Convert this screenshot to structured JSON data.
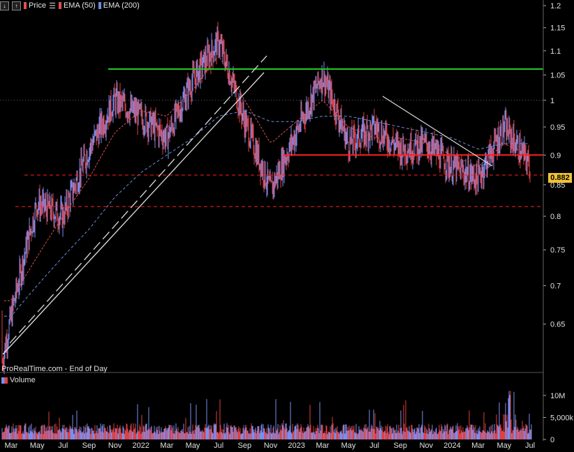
{
  "header": {
    "items": [
      {
        "label": "Price",
        "color": "#e05050"
      },
      {
        "label": "EMA (50)",
        "color": "#e05050"
      },
      {
        "label": "EMA (200)",
        "color": "#6a8fd8"
      }
    ]
  },
  "footer_source": "ProRealTime.com - End of Day",
  "volume_title": "Volume",
  "last_price_label": "0.882",
  "colors": {
    "up": "#7a8ef0",
    "down": "#e04040",
    "green_line": "#22cc22",
    "support": "#ff2020",
    "trend": "#dddddd",
    "ema50": "#e05050",
    "ema200": "#6a8fd8",
    "tag": "#f1c232"
  },
  "chart_data": [
    {
      "type": "line",
      "title": "",
      "series": [
        {
          "name": "Price",
          "x": [
            "2021-03",
            "2021-05",
            "2021-07",
            "2021-09",
            "2021-11",
            "2022-01",
            "2022-03",
            "2022-05",
            "2022-07",
            "2022-09",
            "2022-11",
            "2023-01",
            "2023-03",
            "2023-05",
            "2023-07",
            "2023-09",
            "2023-11",
            "2024-01",
            "2024-03",
            "2024-05",
            "2024-07"
          ],
          "values": [
            0.66,
            0.82,
            0.8,
            0.91,
            1.0,
            0.97,
            0.93,
            1.04,
            1.12,
            0.96,
            0.84,
            0.94,
            1.05,
            0.92,
            0.95,
            0.91,
            0.92,
            0.88,
            0.86,
            0.95,
            0.882
          ]
        },
        {
          "name": "EMA (50)",
          "values": [
            0.68,
            0.74,
            0.8,
            0.86,
            0.94,
            0.98,
            0.97,
            1.02,
            1.09,
            1.0,
            0.92,
            0.96,
            1.0,
            0.95,
            0.93,
            0.93,
            0.92,
            0.9,
            0.88,
            0.92,
            0.9
          ]
        },
        {
          "name": "EMA (200)",
          "values": [
            0.66,
            0.7,
            0.74,
            0.78,
            0.83,
            0.87,
            0.9,
            0.93,
            0.97,
            0.98,
            0.96,
            0.96,
            0.97,
            0.97,
            0.96,
            0.95,
            0.94,
            0.93,
            0.91,
            0.92,
            0.92
          ]
        }
      ],
      "y_ticks": [
        1.2,
        1.15,
        1.1,
        1.05,
        1,
        0.95,
        0.9,
        0.85,
        0.8,
        0.75,
        0.7,
        0.65
      ],
      "y_scale": "log",
      "ylim": [
        0.61,
        1.2
      ],
      "x_ticks": [
        "Mar",
        "May",
        "Jul",
        "Sep",
        "Nov",
        "2022",
        "Mar",
        "May",
        "Jul",
        "Sep",
        "Nov",
        "2023",
        "Mar",
        "May",
        "Jul",
        "Sep",
        "Nov",
        "2024",
        "Mar",
        "May",
        "Jul"
      ],
      "levels": {
        "resistance": 1.062,
        "support": 0.9,
        "dashed_upper": 0.866,
        "dashed_lower": 0.815,
        "last": 0.882
      },
      "grid": false
    },
    {
      "type": "bar",
      "title": "Volume",
      "y_ticks": [
        "10M",
        "5,000k",
        "0"
      ],
      "description_levels": {
        "max": 13000000
      }
    }
  ]
}
